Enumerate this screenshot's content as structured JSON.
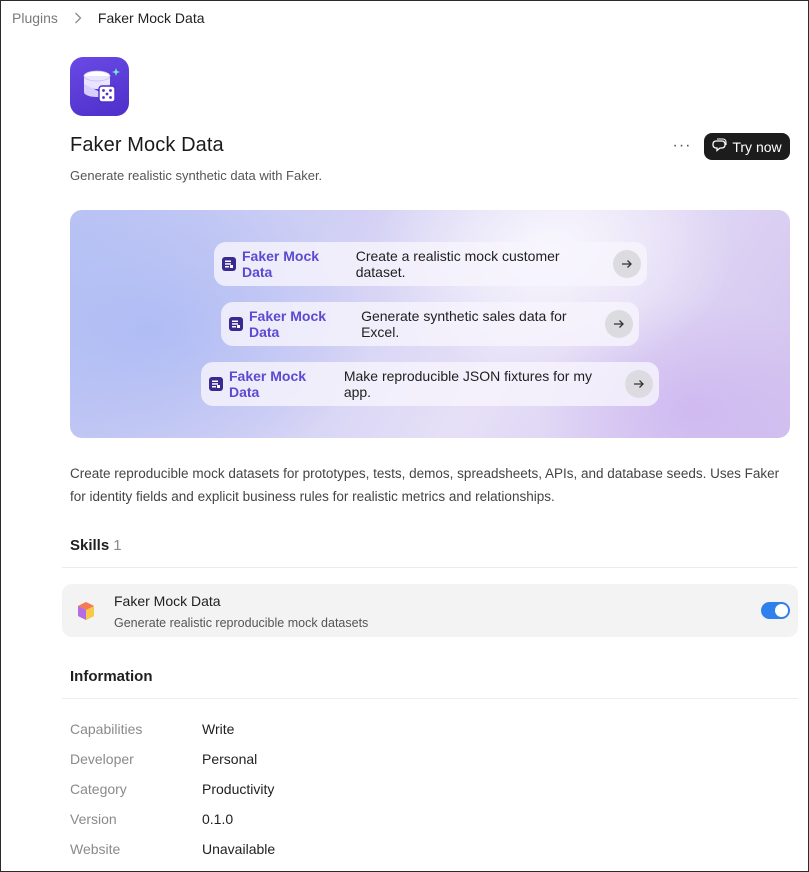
{
  "breadcrumb": {
    "parent": "Plugins",
    "current": "Faker Mock Data"
  },
  "plugin": {
    "name": "Faker Mock Data",
    "tagline": "Generate realistic synthetic data with Faker.",
    "accent_color": "#5b3fd6",
    "icon": "database-dice-icon"
  },
  "actions": {
    "more": "···",
    "try_now": "Try now"
  },
  "prompts": [
    {
      "plugin": "Faker Mock Data",
      "text": "Create a realistic mock customer dataset."
    },
    {
      "plugin": "Faker Mock Data",
      "text": "Generate synthetic sales data for Excel."
    },
    {
      "plugin": "Faker Mock Data",
      "text": "Make reproducible JSON fixtures for my app."
    }
  ],
  "description": "Create reproducible mock datasets for prototypes, tests, demos, spreadsheets, APIs, and database seeds. Uses Faker for identity fields and explicit business rules for realistic metrics and relationships.",
  "skills": {
    "heading": "Skills",
    "count": "1",
    "items": [
      {
        "name": "Faker Mock Data",
        "description": "Generate realistic reproducible mock datasets",
        "enabled": true
      }
    ]
  },
  "information": {
    "heading": "Information",
    "rows": [
      {
        "label": "Capabilities",
        "value": "Write"
      },
      {
        "label": "Developer",
        "value": "Personal"
      },
      {
        "label": "Category",
        "value": "Productivity"
      },
      {
        "label": "Version",
        "value": "0.1.0"
      },
      {
        "label": "Website",
        "value": "Unavailable"
      }
    ]
  }
}
